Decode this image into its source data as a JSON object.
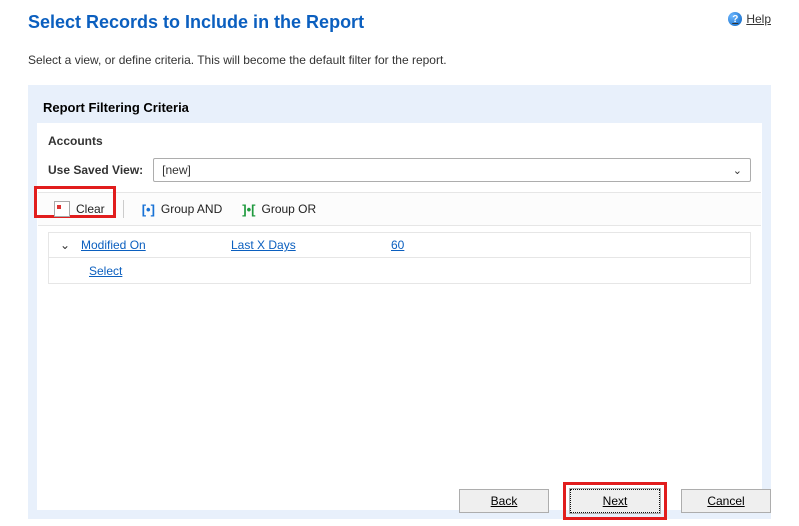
{
  "header": {
    "title": "Select Records to Include in the Report",
    "help": "Help"
  },
  "subtitle": "Select a view, or define criteria. This will become the default filter for the report.",
  "criteria": {
    "panel_title": "Report Filtering Criteria",
    "section": "Accounts",
    "saved_view_label": "Use Saved View:",
    "saved_view_value": "[new]",
    "toolbar": {
      "clear": "Clear",
      "group_and": "Group AND",
      "group_or": "Group OR"
    },
    "condition": {
      "expand_glyph": "⌄",
      "field": "Modified On",
      "operator": "Last X Days",
      "value": "60"
    },
    "select_link": "Select"
  },
  "footer": {
    "back": "Back",
    "next": "Next",
    "cancel": "Cancel"
  }
}
